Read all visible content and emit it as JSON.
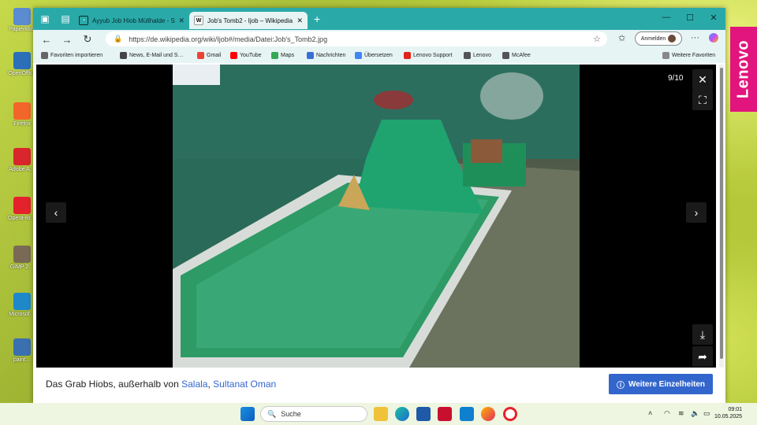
{
  "desktop": {
    "icons": [
      {
        "label": "Papierkorb",
        "color": "#5b8bd0"
      },
      {
        "label": "OpenOffice",
        "color": "#2a6fb8"
      },
      {
        "label": "Firefox",
        "color": "#f2662a"
      },
      {
        "label": "Adobe A…",
        "color": "#d8262c"
      },
      {
        "label": "Opera-Br…",
        "color": "#e4222c"
      },
      {
        "label": "GIMP 2…",
        "color": "#7a6a55"
      },
      {
        "label": "Microsof…",
        "color": "#1e88c9"
      },
      {
        "label": "paint…",
        "color": "#3a6fb0"
      }
    ],
    "brand": "Lenovo"
  },
  "browser": {
    "tabs": [
      {
        "title": "Ayyub Job Hiob Müllhalde - Such",
        "active": false
      },
      {
        "title": "Job's Tomb2 - Ijob – Wikipedia",
        "active": true,
        "favicon": "W"
      }
    ],
    "url": "https://de.wikipedia.org/wiki/Ijob#/media/Datei:Job's_Tomb2.jpg",
    "signin_label": "Anmelden",
    "favorites": [
      {
        "label": "Favoriten importieren",
        "color": "#666"
      },
      {
        "label": "News, E-Mail und S…",
        "color": "#444"
      },
      {
        "label": "Gmail",
        "color": "#ea4335"
      },
      {
        "label": "YouTube",
        "color": "#ff0000"
      },
      {
        "label": "Maps",
        "color": "#34a853"
      },
      {
        "label": "Nachrichten",
        "color": "#3b6fd6"
      },
      {
        "label": "Übersetzen",
        "color": "#4285f4"
      },
      {
        "label": "Lenovo Support",
        "color": "#e2231a"
      },
      {
        "label": "Lenovo",
        "color": "#555"
      },
      {
        "label": "McAfee",
        "color": "#555"
      }
    ],
    "other_favorites": "Weitere Favoriten"
  },
  "viewer": {
    "counter": "9/10",
    "caption_prefix": "Das Grab Hiobs, außerhalb von ",
    "caption_link1": "Salala",
    "caption_sep": ", ",
    "caption_link2": "Sultanat Oman",
    "details_label": "Weitere Einzelheiten"
  },
  "taskbar": {
    "search_label": "Suche",
    "time": "09:01",
    "date": "10.05.2025"
  }
}
